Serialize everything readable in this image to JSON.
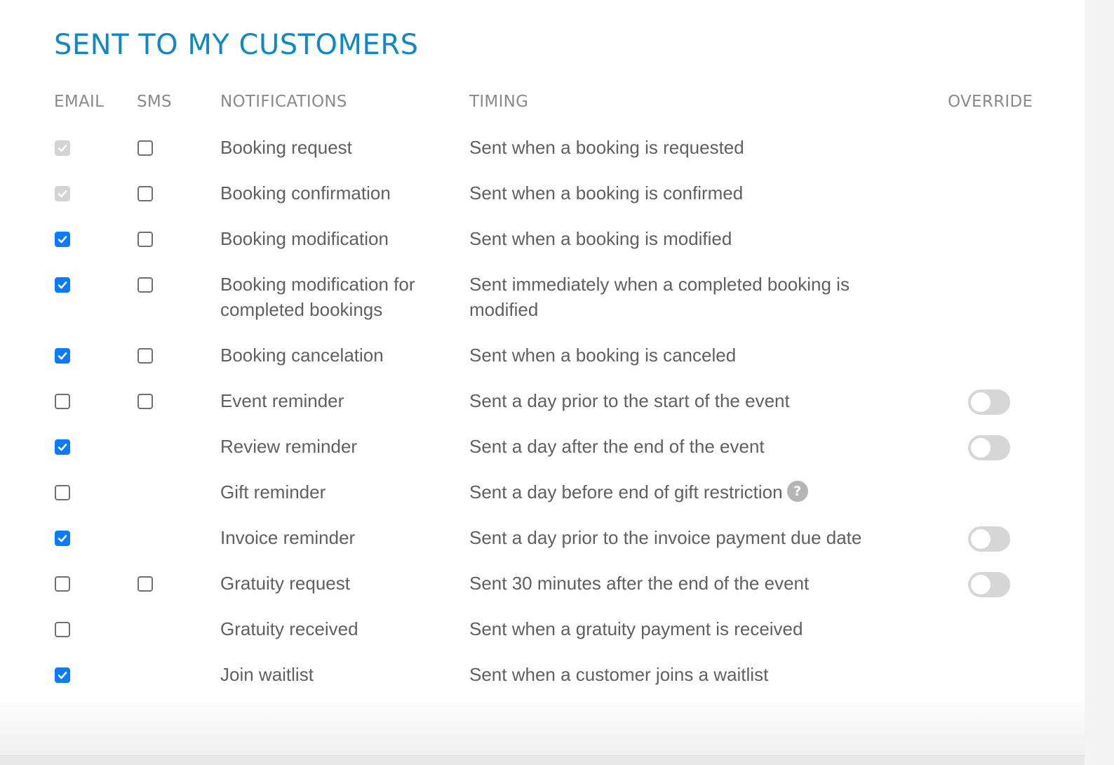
{
  "section": {
    "title": "SENT TO MY CUSTOMERS"
  },
  "columns": {
    "email": "EMAIL",
    "sms": "SMS",
    "notifications": "NOTIFICATIONS",
    "timing": "TIMING",
    "override": "OVERRIDE"
  },
  "colors": {
    "title": "#1188c4",
    "checkbox_checked": "#0a7bff",
    "checkbox_disabled": "#d4d4d4",
    "toggle_off": "#d6d6d6",
    "text": "#606060",
    "header_text": "#8a8a8a"
  },
  "rows": [
    {
      "notification": "Booking request",
      "timing": "Sent when a booking is requested",
      "email": {
        "checked": true,
        "disabled": true
      },
      "sms": {
        "checked": false
      },
      "override": null,
      "help": false
    },
    {
      "notification": "Booking confirmation",
      "timing": "Sent when a booking is confirmed",
      "email": {
        "checked": true,
        "disabled": true
      },
      "sms": {
        "checked": false
      },
      "override": null,
      "help": false
    },
    {
      "notification": "Booking modification",
      "timing": "Sent when a booking is modified",
      "email": {
        "checked": true,
        "disabled": false
      },
      "sms": {
        "checked": false
      },
      "override": null,
      "help": false
    },
    {
      "notification": "Booking modification for completed bookings",
      "timing": "Sent immediately when a completed booking is modified",
      "email": {
        "checked": true,
        "disabled": false
      },
      "sms": {
        "checked": false
      },
      "override": null,
      "help": false
    },
    {
      "notification": "Booking cancelation",
      "timing": "Sent when a booking is canceled",
      "email": {
        "checked": true,
        "disabled": false
      },
      "sms": {
        "checked": false
      },
      "override": null,
      "help": false
    },
    {
      "notification": "Event reminder",
      "timing": "Sent a day prior to the start of the event",
      "email": {
        "checked": false,
        "disabled": false
      },
      "sms": {
        "checked": false
      },
      "override": {
        "on": false
      },
      "help": false
    },
    {
      "notification": "Review reminder",
      "timing": "Sent a day after the end of the event",
      "email": {
        "checked": true,
        "disabled": false
      },
      "sms": null,
      "override": {
        "on": false
      },
      "help": false
    },
    {
      "notification": "Gift reminder",
      "timing": "Sent a day before end of gift restriction",
      "email": {
        "checked": false,
        "disabled": false
      },
      "sms": null,
      "override": null,
      "help": true
    },
    {
      "notification": "Invoice reminder",
      "timing": "Sent a day prior to the invoice payment due date",
      "email": {
        "checked": true,
        "disabled": false
      },
      "sms": null,
      "override": {
        "on": false
      },
      "help": false
    },
    {
      "notification": "Gratuity request",
      "timing": "Sent 30 minutes after the end of the event",
      "email": {
        "checked": false,
        "disabled": false
      },
      "sms": {
        "checked": false
      },
      "override": {
        "on": false
      },
      "help": false
    },
    {
      "notification": "Gratuity received",
      "timing": "Sent when a gratuity payment is received",
      "email": {
        "checked": false,
        "disabled": false
      },
      "sms": null,
      "override": null,
      "help": false
    },
    {
      "notification": "Join waitlist",
      "timing": "Sent when a customer joins a waitlist",
      "email": {
        "checked": true,
        "disabled": false
      },
      "sms": null,
      "override": null,
      "help": false
    }
  ],
  "icons": {
    "help": "?",
    "check": "checkmark-icon"
  }
}
